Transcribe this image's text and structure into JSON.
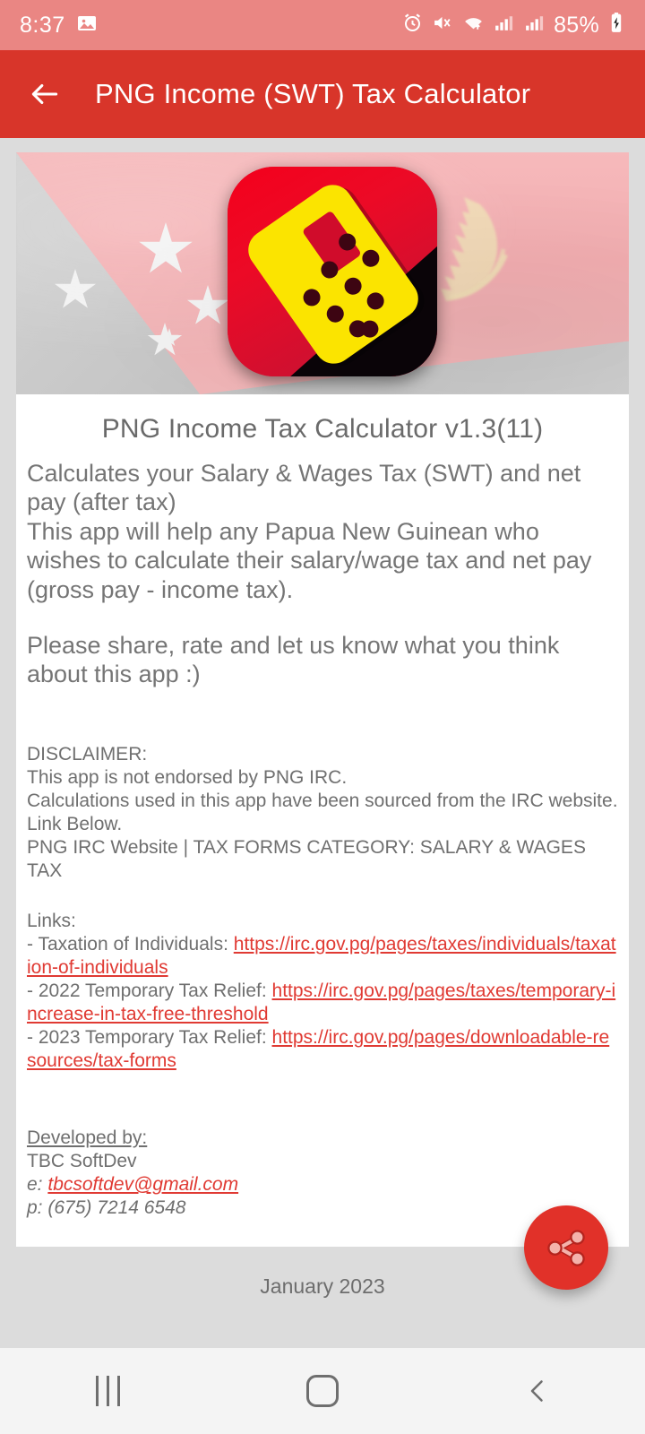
{
  "status_bar": {
    "time": "8:37",
    "battery_percent": "85%",
    "icons": [
      "image-notification-icon",
      "alarm-icon",
      "mute-vibrate-icon",
      "wifi-icon",
      "signal-icon",
      "signal-icon",
      "battery-charging-icon"
    ],
    "background_color": "#ea8683"
  },
  "app_bar": {
    "title": "PNG Income (SWT) Tax Calculator",
    "back_label": "Back",
    "background_color": "#d8352a",
    "text_color": "#ffffff"
  },
  "hero": {
    "alt": "Papua New Guinea flag with app icon",
    "app_icon_alt": "yellow calculator on red rounded square"
  },
  "card": {
    "title": "PNG Income Tax Calculator v1.3(11)",
    "description": "Calculates your Salary & Wages Tax (SWT) and net pay (after tax)\nThis app will help any Papua New Guinean who wishes to calculate their salary/wage tax and net pay (gross pay - income tax).",
    "share_prompt": "Please share, rate and let us know what you think about this app :)",
    "disclaimer_heading": "DISCLAIMER:",
    "disclaimer_body": "This app is not endorsed by PNG IRC.\nCalculations used in this app have been sourced from the IRC website. Link Below.\nPNG IRC Website | TAX FORMS CATEGORY: SALARY & WAGES TAX",
    "links_heading": "Links:",
    "links": [
      {
        "label": "- Taxation of Individuals: ",
        "url": "https://irc.gov.pg/pages/taxes/individuals/taxation-of-individuals"
      },
      {
        "label": "- 2022 Temporary Tax Relief: ",
        "url": "https://irc.gov.pg/pages/taxes/temporary-increase-in-tax-free-threshold"
      },
      {
        "label": "- 2023 Temporary Tax Relief: ",
        "url": "https://irc.gov.pg/pages/downloadable-resources/tax-forms"
      }
    ],
    "developed_by_heading": "Developed by:",
    "developer_name": "TBC SoftDev",
    "email_prefix": "e: ",
    "email": "tbcsoftdev@gmail.com",
    "phone": "p: (675) 7214 6548"
  },
  "fab": {
    "name": "share",
    "icon": "share-icon",
    "background_color": "#e13129",
    "icon_color": "#f4b2ab"
  },
  "footer": {
    "date": "January 2023"
  },
  "nav_bar": {
    "recents_label": "Recents",
    "home_label": "Home",
    "back_label": "Back"
  }
}
